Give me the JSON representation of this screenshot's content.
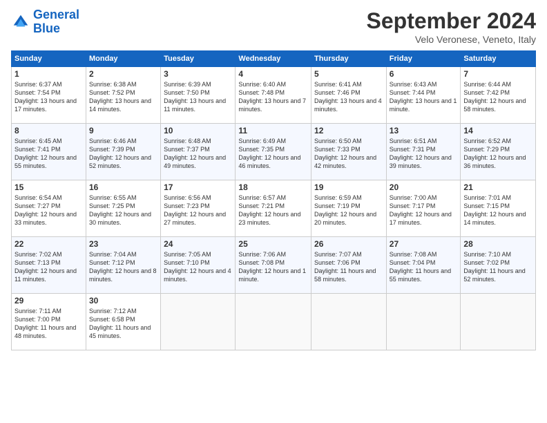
{
  "header": {
    "logo_line1": "General",
    "logo_line2": "Blue",
    "month_title": "September 2024",
    "location": "Velo Veronese, Veneto, Italy"
  },
  "weekdays": [
    "Sunday",
    "Monday",
    "Tuesday",
    "Wednesday",
    "Thursday",
    "Friday",
    "Saturday"
  ],
  "weeks": [
    [
      {
        "day": "1",
        "sunrise": "6:37 AM",
        "sunset": "7:54 PM",
        "daylight": "13 hours and 17 minutes."
      },
      {
        "day": "2",
        "sunrise": "6:38 AM",
        "sunset": "7:52 PM",
        "daylight": "13 hours and 14 minutes."
      },
      {
        "day": "3",
        "sunrise": "6:39 AM",
        "sunset": "7:50 PM",
        "daylight": "13 hours and 11 minutes."
      },
      {
        "day": "4",
        "sunrise": "6:40 AM",
        "sunset": "7:48 PM",
        "daylight": "13 hours and 7 minutes."
      },
      {
        "day": "5",
        "sunrise": "6:41 AM",
        "sunset": "7:46 PM",
        "daylight": "13 hours and 4 minutes."
      },
      {
        "day": "6",
        "sunrise": "6:43 AM",
        "sunset": "7:44 PM",
        "daylight": "13 hours and 1 minute."
      },
      {
        "day": "7",
        "sunrise": "6:44 AM",
        "sunset": "7:42 PM",
        "daylight": "12 hours and 58 minutes."
      }
    ],
    [
      {
        "day": "8",
        "sunrise": "6:45 AM",
        "sunset": "7:41 PM",
        "daylight": "12 hours and 55 minutes."
      },
      {
        "day": "9",
        "sunrise": "6:46 AM",
        "sunset": "7:39 PM",
        "daylight": "12 hours and 52 minutes."
      },
      {
        "day": "10",
        "sunrise": "6:48 AM",
        "sunset": "7:37 PM",
        "daylight": "12 hours and 49 minutes."
      },
      {
        "day": "11",
        "sunrise": "6:49 AM",
        "sunset": "7:35 PM",
        "daylight": "12 hours and 46 minutes."
      },
      {
        "day": "12",
        "sunrise": "6:50 AM",
        "sunset": "7:33 PM",
        "daylight": "12 hours and 42 minutes."
      },
      {
        "day": "13",
        "sunrise": "6:51 AM",
        "sunset": "7:31 PM",
        "daylight": "12 hours and 39 minutes."
      },
      {
        "day": "14",
        "sunrise": "6:52 AM",
        "sunset": "7:29 PM",
        "daylight": "12 hours and 36 minutes."
      }
    ],
    [
      {
        "day": "15",
        "sunrise": "6:54 AM",
        "sunset": "7:27 PM",
        "daylight": "12 hours and 33 minutes."
      },
      {
        "day": "16",
        "sunrise": "6:55 AM",
        "sunset": "7:25 PM",
        "daylight": "12 hours and 30 minutes."
      },
      {
        "day": "17",
        "sunrise": "6:56 AM",
        "sunset": "7:23 PM",
        "daylight": "12 hours and 27 minutes."
      },
      {
        "day": "18",
        "sunrise": "6:57 AM",
        "sunset": "7:21 PM",
        "daylight": "12 hours and 23 minutes."
      },
      {
        "day": "19",
        "sunrise": "6:59 AM",
        "sunset": "7:19 PM",
        "daylight": "12 hours and 20 minutes."
      },
      {
        "day": "20",
        "sunrise": "7:00 AM",
        "sunset": "7:17 PM",
        "daylight": "12 hours and 17 minutes."
      },
      {
        "day": "21",
        "sunrise": "7:01 AM",
        "sunset": "7:15 PM",
        "daylight": "12 hours and 14 minutes."
      }
    ],
    [
      {
        "day": "22",
        "sunrise": "7:02 AM",
        "sunset": "7:13 PM",
        "daylight": "12 hours and 11 minutes."
      },
      {
        "day": "23",
        "sunrise": "7:04 AM",
        "sunset": "7:12 PM",
        "daylight": "12 hours and 8 minutes."
      },
      {
        "day": "24",
        "sunrise": "7:05 AM",
        "sunset": "7:10 PM",
        "daylight": "12 hours and 4 minutes."
      },
      {
        "day": "25",
        "sunrise": "7:06 AM",
        "sunset": "7:08 PM",
        "daylight": "12 hours and 1 minute."
      },
      {
        "day": "26",
        "sunrise": "7:07 AM",
        "sunset": "7:06 PM",
        "daylight": "11 hours and 58 minutes."
      },
      {
        "day": "27",
        "sunrise": "7:08 AM",
        "sunset": "7:04 PM",
        "daylight": "11 hours and 55 minutes."
      },
      {
        "day": "28",
        "sunrise": "7:10 AM",
        "sunset": "7:02 PM",
        "daylight": "11 hours and 52 minutes."
      }
    ],
    [
      {
        "day": "29",
        "sunrise": "7:11 AM",
        "sunset": "7:00 PM",
        "daylight": "11 hours and 48 minutes."
      },
      {
        "day": "30",
        "sunrise": "7:12 AM",
        "sunset": "6:58 PM",
        "daylight": "11 hours and 45 minutes."
      },
      null,
      null,
      null,
      null,
      null
    ]
  ]
}
